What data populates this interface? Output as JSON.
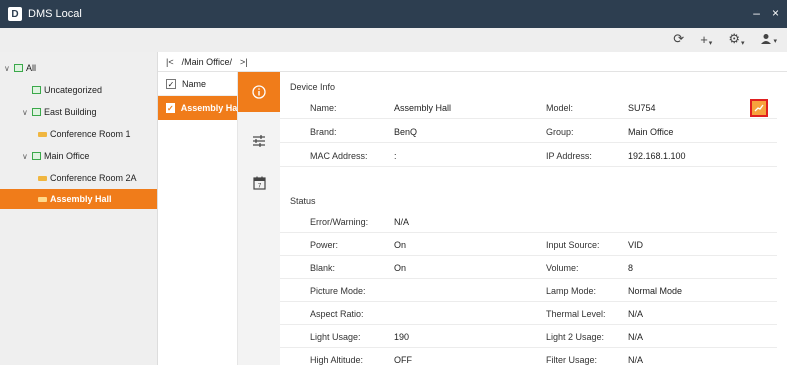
{
  "app": {
    "title": "DMS Local",
    "logo_letter": "D",
    "minimize": "–",
    "close": "×"
  },
  "toolbar": {
    "refresh": "⟳",
    "add": "+",
    "settings": "⚙",
    "user": "👤",
    "caret": "▾"
  },
  "sidebar": {
    "items": [
      {
        "label": "All",
        "type": "group",
        "chevron": "∨"
      },
      {
        "label": "Uncategorized",
        "type": "group"
      },
      {
        "label": "East Building",
        "type": "group",
        "chevron": "∨"
      },
      {
        "label": "Conference Room 1",
        "type": "device"
      },
      {
        "label": "Main Office",
        "type": "group",
        "chevron": "∨"
      },
      {
        "label": "Conference Room 2A",
        "type": "device"
      },
      {
        "label": "Assembly Hall",
        "type": "device",
        "selected": true
      }
    ]
  },
  "breadcrumb": {
    "back": "|<",
    "path": "/Main Office/",
    "forward": ">|"
  },
  "device_list": {
    "header": "Name",
    "checkmark": "✓",
    "rows": [
      {
        "name": "Assembly Hall"
      }
    ]
  },
  "device_info": {
    "title": "Device Info",
    "rows": [
      {
        "l1": "Name:",
        "v1": "Assembly Hall",
        "l2": "Model:",
        "v2": "SU754"
      },
      {
        "l1": "Brand:",
        "v1": "BenQ",
        "l2": "Group:",
        "v2": "Main Office"
      },
      {
        "l1": "MAC Address:",
        "v1": ":",
        "l2": "IP Address:",
        "v2": "192.168.1.100"
      }
    ]
  },
  "status": {
    "title": "Status",
    "rows": [
      {
        "l1": "Error/Warning:",
        "v1": "N/A",
        "l2": "",
        "v2": ""
      },
      {
        "l1": "Power:",
        "v1": "On",
        "l2": "Input Source:",
        "v2": "VID"
      },
      {
        "l1": "Blank:",
        "v1": "On",
        "l2": "Volume:",
        "v2": "8"
      },
      {
        "l1": "Picture Mode:",
        "v1": "",
        "l2": "Lamp Mode:",
        "v2": "Normal Mode"
      },
      {
        "l1": "Aspect Ratio:",
        "v1": "",
        "l2": "Thermal Level:",
        "v2": "N/A"
      },
      {
        "l1": "Light Usage:",
        "v1": "190",
        "l2": "Light 2 Usage:",
        "v2": "N/A"
      },
      {
        "l1": "High Altitude:",
        "v1": "OFF",
        "l2": "Filter Usage:",
        "v2": "N/A"
      }
    ]
  },
  "colors": {
    "accent": "#f07c1a",
    "titlebar": "#2d3e50",
    "highlight_border": "#e02020"
  }
}
